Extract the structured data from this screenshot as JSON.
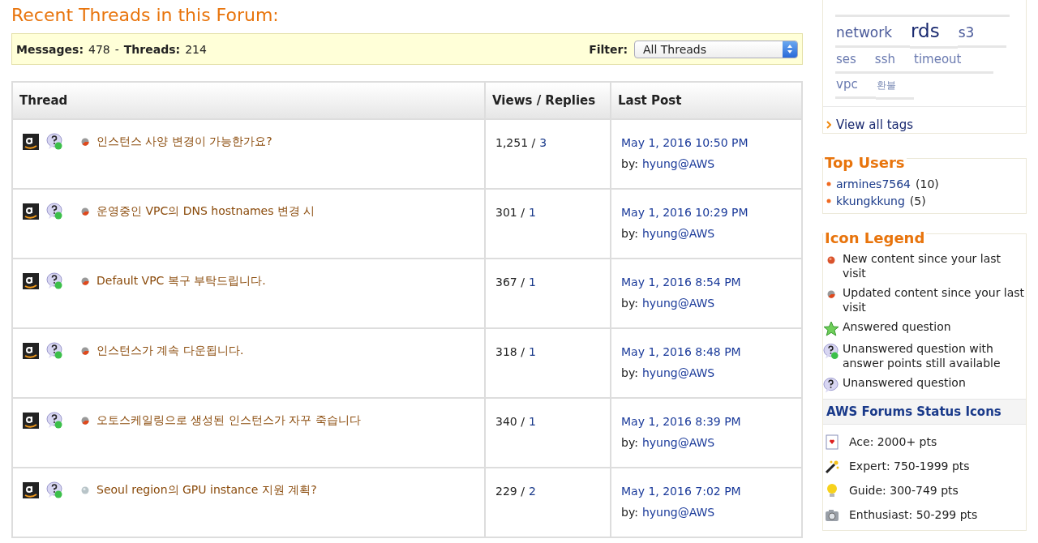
{
  "heading": "Recent Threads in this Forum:",
  "summary": {
    "messages_label": "Messages:",
    "messages": "478",
    "separator": "-",
    "threads_label": "Threads:",
    "threads": "214",
    "filter_label": "Filter:",
    "filter_value": "All Threads"
  },
  "table": {
    "columns": [
      "Thread",
      "Views / Replies",
      "Last Post"
    ],
    "rows": [
      {
        "kind": "updated",
        "title": "인스턴스 사양 변경이 가능한가요?",
        "views": "1,251 /",
        "replies": "3",
        "date": "May 1, 2016 10:50 PM",
        "by_label": "by:",
        "author": "hyung@AWS"
      },
      {
        "kind": "updated",
        "title": "운영중인 VPC의 DNS hostnames 변경 시",
        "views": "301 /",
        "replies": "1",
        "date": "May 1, 2016 10:29 PM",
        "by_label": "by:",
        "author": "hyung@AWS"
      },
      {
        "kind": "updated",
        "title": "Default VPC 복구 부탁드립니다.",
        "views": "367 /",
        "replies": "1",
        "date": "May 1, 2016 8:54 PM",
        "by_label": "by:",
        "author": "hyung@AWS"
      },
      {
        "kind": "updated",
        "title": "인스턴스가 계속 다운됩니다.",
        "views": "318 /",
        "replies": "1",
        "date": "May 1, 2016 8:48 PM",
        "by_label": "by:",
        "author": "hyung@AWS"
      },
      {
        "kind": "updated",
        "title": "오토스케일링으로 생성된 인스턴스가 자꾸 죽습니다",
        "views": "340 /",
        "replies": "1",
        "date": "May 1, 2016 8:39 PM",
        "by_label": "by:",
        "author": "hyung@AWS"
      },
      {
        "kind": "read",
        "title": "Seoul region의 GPU instance 지원 계획?",
        "views": "229 /",
        "replies": "2",
        "date": "May 1, 2016 7:02 PM",
        "by_label": "by:",
        "author": "hyung@AWS"
      }
    ]
  },
  "tags": {
    "items": [
      {
        "label": "network",
        "kind": "medium"
      },
      {
        "label": "rds",
        "kind": "large"
      },
      {
        "label": "s3",
        "kind": "medium"
      },
      {
        "label": "ses",
        "kind": "small"
      },
      {
        "label": "ssh",
        "kind": "small"
      },
      {
        "label": "timeout",
        "kind": "small"
      },
      {
        "label": "vpc",
        "kind": "small"
      },
      {
        "label": "환불",
        "kind": "tiny"
      }
    ],
    "view_all": "View all tags"
  },
  "top_users": {
    "title": "Top Users",
    "users": [
      {
        "name": "armines7564",
        "count": "(10)"
      },
      {
        "name": "kkungkkung",
        "count": "(5)"
      }
    ]
  },
  "legend": {
    "title": "Icon Legend",
    "items": [
      {
        "kind": "new",
        "text": "New content since your last visit"
      },
      {
        "kind": "updated",
        "text": "Updated content since your last visit"
      },
      {
        "kind": "answered",
        "text": "Answered question"
      },
      {
        "kind": "points",
        "text": "Unanswered question with answer points still available"
      },
      {
        "kind": "unanswered",
        "text": "Unanswered question"
      }
    ],
    "status_title": "AWS Forums Status Icons",
    "status_items": [
      {
        "kind": "ace",
        "text": "Ace: 2000+ pts"
      },
      {
        "kind": "expert",
        "text": "Expert: 750-1999 pts"
      },
      {
        "kind": "guide",
        "text": "Guide: 300-749 pts"
      },
      {
        "kind": "enthusiast",
        "text": "Enthusiast: 50-299 pts"
      }
    ]
  }
}
